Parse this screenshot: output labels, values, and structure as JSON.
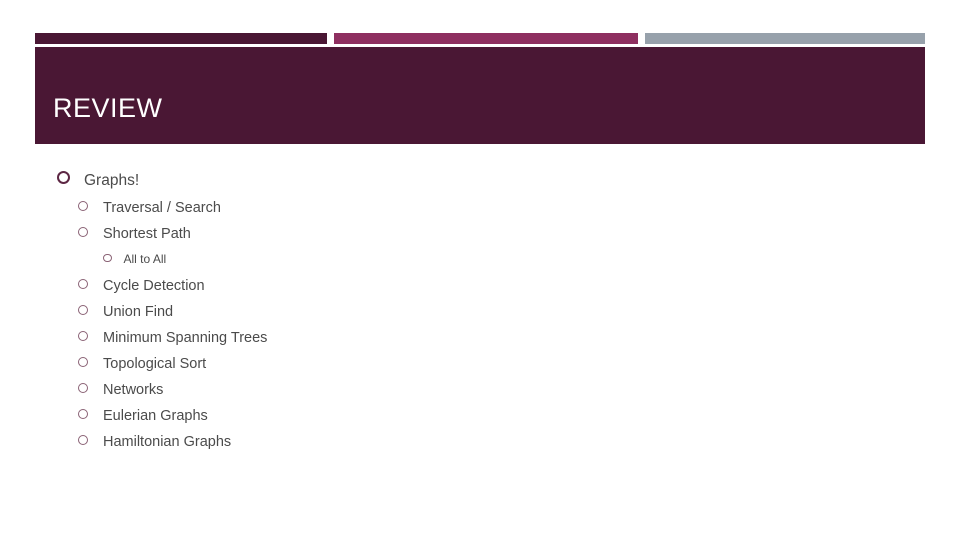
{
  "slide": {
    "title": "REVIEW",
    "background": "#ffffff"
  },
  "colors": {
    "header_band": "#4a1734",
    "bar_dark_plum": "#4a1734",
    "bar_raspberry": "#8e2f60",
    "bar_gray_blue": "#97a1ab",
    "title_text": "#ffffff",
    "body_text": "#4b4b4b",
    "bullet_level1": "#5d2744",
    "bullet_level2": "#8a6275"
  },
  "decorative_bars": [
    {
      "name": "bar-dark-plum",
      "color": "#4a1734"
    },
    {
      "name": "bar-raspberry",
      "color": "#8e2f60"
    },
    {
      "name": "bar-gray-blue",
      "color": "#97a1ab"
    }
  ],
  "outline": [
    {
      "level": 1,
      "label": "Graphs!",
      "bullet": "ring-bullet-icon"
    },
    {
      "level": 2,
      "label": "Traversal / Search",
      "bullet": "ring-bullet-icon"
    },
    {
      "level": 2,
      "label": "Shortest Path",
      "bullet": "ring-bullet-icon"
    },
    {
      "level": 3,
      "label": "All to All",
      "bullet": "ring-bullet-icon"
    },
    {
      "level": 2,
      "label": "Cycle Detection",
      "bullet": "ring-bullet-icon"
    },
    {
      "level": 2,
      "label": "Union Find",
      "bullet": "ring-bullet-icon"
    },
    {
      "level": 2,
      "label": "Minimum Spanning Trees",
      "bullet": "ring-bullet-icon"
    },
    {
      "level": 2,
      "label": "Topological Sort",
      "bullet": "ring-bullet-icon"
    },
    {
      "level": 2,
      "label": "Networks",
      "bullet": "ring-bullet-icon"
    },
    {
      "level": 2,
      "label": "Eulerian Graphs",
      "bullet": "ring-bullet-icon"
    },
    {
      "level": 2,
      "label": "Hamiltonian Graphs",
      "bullet": "ring-bullet-icon"
    }
  ]
}
